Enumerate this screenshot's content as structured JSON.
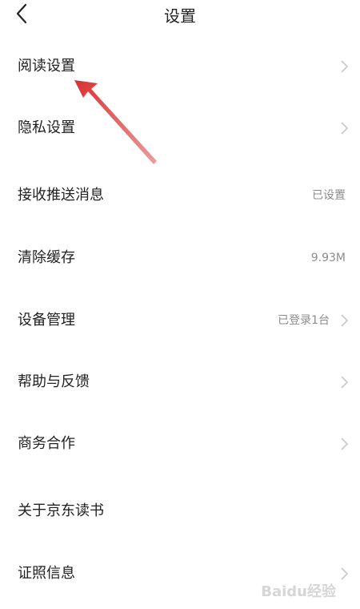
{
  "header": {
    "title": "设置"
  },
  "settings": [
    {
      "label": "阅读设置",
      "value": "",
      "chevron": true
    },
    {
      "label": "隐私设置",
      "value": "",
      "chevron": true
    },
    {
      "label": "接收推送消息",
      "value": "已设置",
      "chevron": false
    },
    {
      "label": "清除缓存",
      "value": "9.93M",
      "chevron": false
    },
    {
      "label": "设备管理",
      "value": "已登录1台",
      "chevron": true
    },
    {
      "label": "帮助与反馈",
      "value": "",
      "chevron": true
    },
    {
      "label": "商务合作",
      "value": "",
      "chevron": true
    },
    {
      "label": "关于京东读书",
      "value": "",
      "chevron": false
    },
    {
      "label": "证照信息",
      "value": "",
      "chevron": true
    }
  ],
  "icons": {
    "back": "chevron-left-icon",
    "row_chevron": "chevron-right-icon"
  },
  "colors": {
    "annotation_arrow": "#d93030",
    "chevron": "#c8c8c8",
    "secondary_text": "#8c8c8c"
  },
  "watermark": {
    "text": "Baidu经验"
  }
}
